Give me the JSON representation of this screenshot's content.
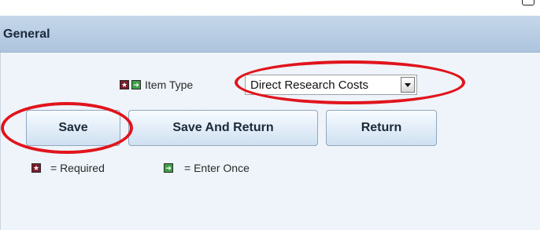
{
  "section": {
    "title": "General"
  },
  "item_type": {
    "label": "Item Type",
    "selected": "Direct Research Costs"
  },
  "buttons": {
    "save": "Save",
    "save_and_return": "Save And Return",
    "return": "Return"
  },
  "legend": {
    "required": "= Required",
    "enter_once": "= Enter Once"
  },
  "colors": {
    "required_icon": "#7a1c2a",
    "enter_once_icon": "#3ea046",
    "highlight": "#e1141c"
  },
  "icons": {
    "required": "star-icon",
    "enter_once": "arrow-right-icon",
    "dropdown": "chevron-down-icon"
  }
}
